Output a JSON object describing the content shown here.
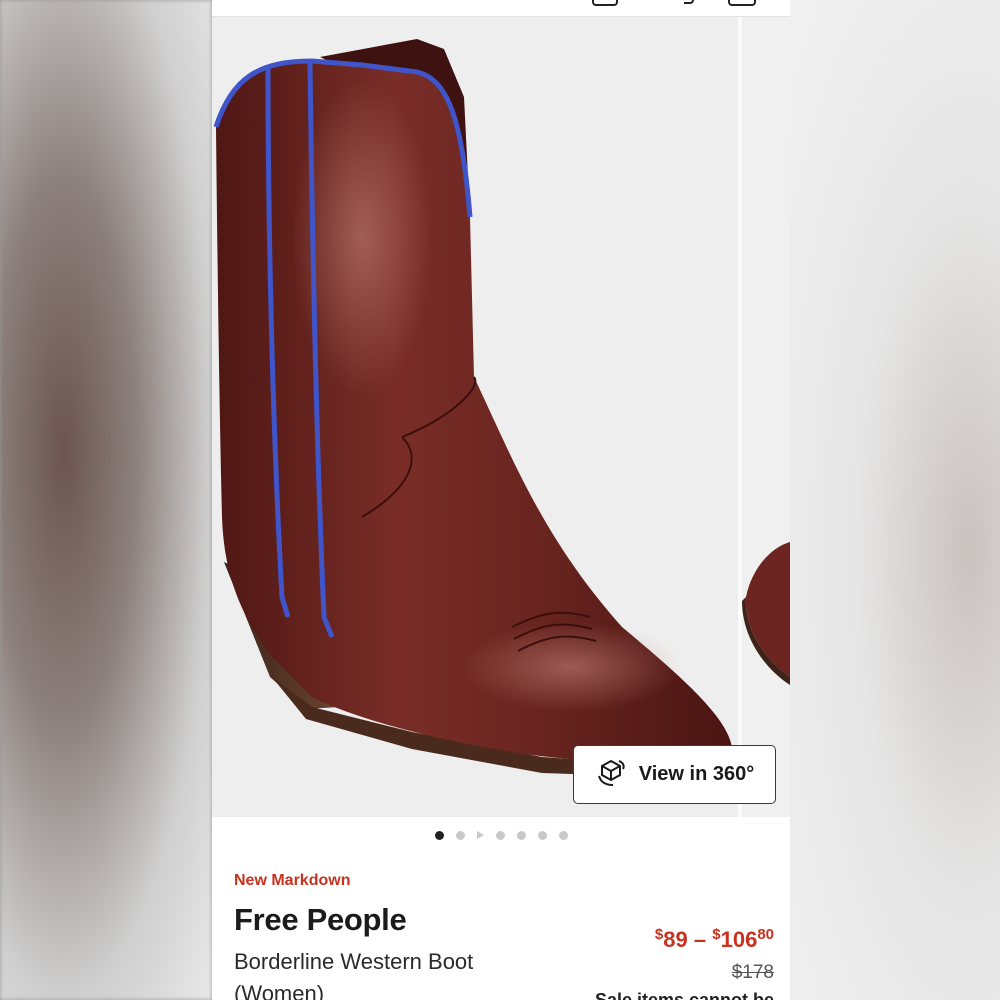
{
  "product": {
    "badge": "New Markdown",
    "brand": "Free People",
    "name": "Borderline Western Boot (Women)",
    "price": {
      "low_dollars": "89",
      "separator": "–",
      "high_dollars": "106",
      "high_cents": "80",
      "currency_symbol": "$"
    },
    "original_price": "$178",
    "sale_note": "Sale items cannot be"
  },
  "gallery": {
    "view_360_label": "View in 360°",
    "dot_count": 6,
    "active_dot": 0
  },
  "colors": {
    "sale_red": "#c8321e",
    "boot_leather": "#6e2722",
    "boot_piping": "#3f55c9"
  },
  "icons": [
    "cube-360-icon"
  ]
}
